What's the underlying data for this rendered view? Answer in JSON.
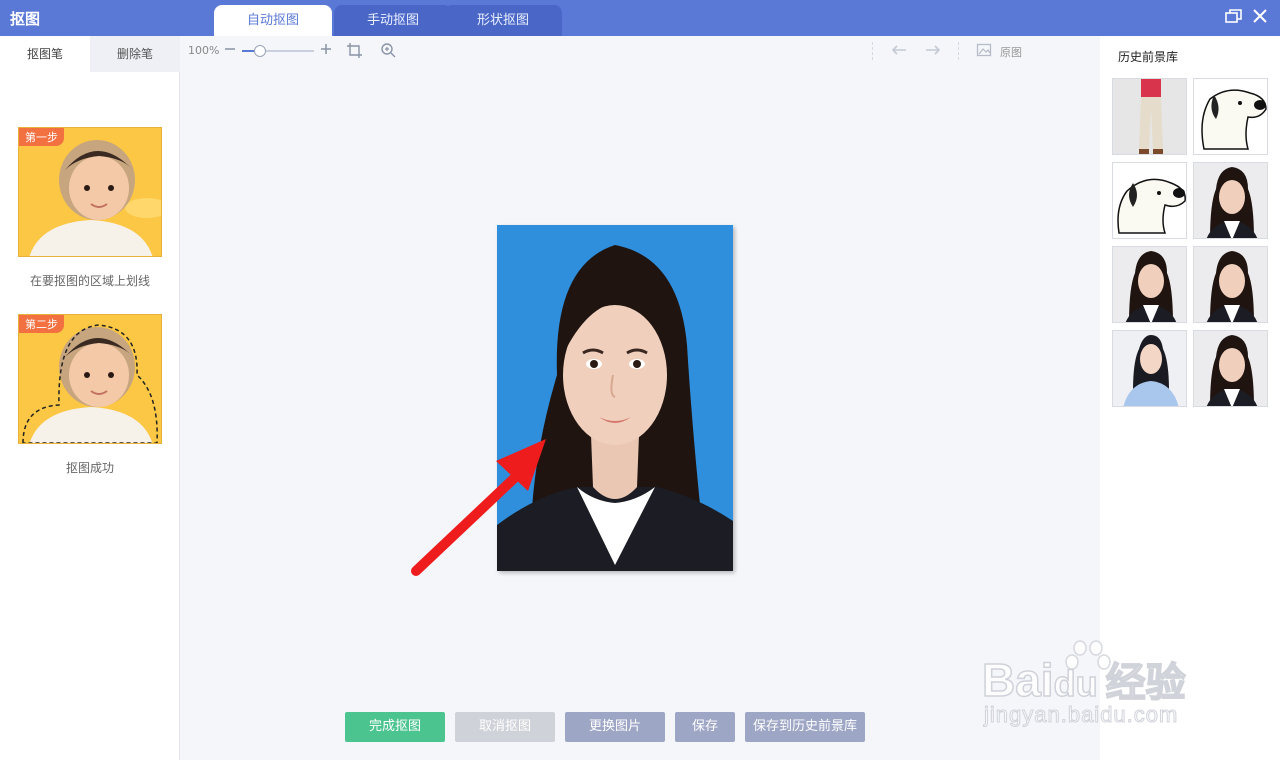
{
  "window": {
    "title": "抠图",
    "tabs": [
      "自动抠图",
      "手动抠图",
      "形状抠图"
    ],
    "restore_icon": "restore-window-icon",
    "close_icon": "close-icon"
  },
  "left_panel": {
    "tabs": [
      "抠图笔",
      "删除笔"
    ],
    "steps": [
      {
        "badge": "第一步",
        "caption": "在要抠图的区域上划线"
      },
      {
        "badge": "第二步",
        "caption": "抠图成功"
      }
    ]
  },
  "toolbar": {
    "zoom_label": "100%",
    "zoom_fraction": 0.25,
    "original_label": "原图"
  },
  "bottom_buttons": {
    "complete": "完成抠图",
    "cancel": "取消抠图",
    "replace": "更换图片",
    "save": "保存",
    "save_history": "保存到历史前景库"
  },
  "right_panel": {
    "title": "历史前景库"
  },
  "watermark": {
    "brand": "Bai",
    "brand2": "du",
    "brand_cn": "经验",
    "url": "jingyan.baidu.com"
  },
  "colors": {
    "titlebar": "#5a78d6",
    "complete_btn": "#4cc490",
    "cancel_btn": "#cfd2d8",
    "other_btn": "#9ea6c6",
    "arrow": "#ee1c1c",
    "photo_bg": "#2f8fdc"
  }
}
